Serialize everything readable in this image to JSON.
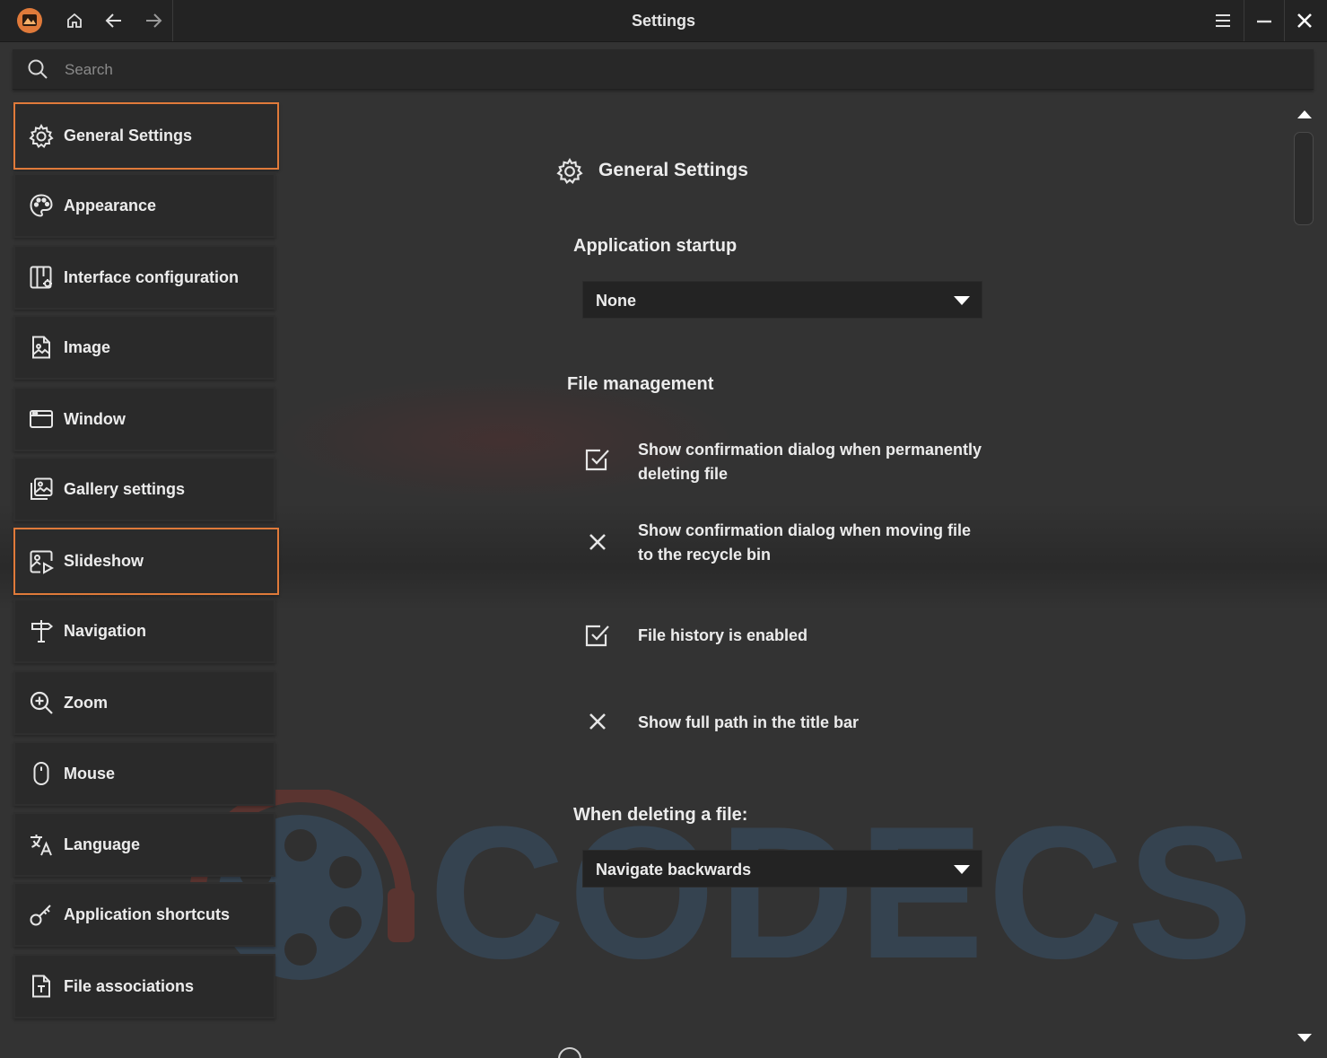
{
  "window": {
    "title": "Settings"
  },
  "search": {
    "placeholder": "Search",
    "value": ""
  },
  "sidebar": {
    "items": [
      {
        "label": "General Settings",
        "icon": "gear-icon",
        "active": true
      },
      {
        "label": "Appearance",
        "icon": "palette-icon",
        "active": false
      },
      {
        "label": "Interface configuration",
        "icon": "layout-gear-icon",
        "active": false
      },
      {
        "label": "Image",
        "icon": "image-file-icon",
        "active": false
      },
      {
        "label": "Window",
        "icon": "window-icon",
        "active": false
      },
      {
        "label": "Gallery settings",
        "icon": "gallery-icon",
        "active": false
      },
      {
        "label": "Slideshow",
        "icon": "slideshow-icon",
        "active": true
      },
      {
        "label": "Navigation",
        "icon": "signpost-icon",
        "active": false
      },
      {
        "label": "Zoom",
        "icon": "zoom-in-icon",
        "active": false
      },
      {
        "label": "Mouse",
        "icon": "mouse-icon",
        "active": false
      },
      {
        "label": "Language",
        "icon": "translate-icon",
        "active": false
      },
      {
        "label": "Application shortcuts",
        "icon": "key-icon",
        "active": false
      },
      {
        "label": "File associations",
        "icon": "file-link-icon",
        "active": false
      }
    ]
  },
  "main": {
    "section_title": "General Settings",
    "startup": {
      "heading": "Application startup",
      "value": "None"
    },
    "file_management": {
      "heading": "File management",
      "options": [
        {
          "label": "Show confirmation dialog when permanently deleting file",
          "checked": true
        },
        {
          "label": "Show confirmation dialog when moving file to the recycle bin",
          "checked": false
        },
        {
          "label": "File history is enabled",
          "checked": true
        },
        {
          "label": "Show full path in the title bar",
          "checked": false
        }
      ]
    },
    "delete_behavior": {
      "heading": "When deleting a file:",
      "value": "Navigate backwards"
    }
  },
  "watermark": {
    "text": "CODECS"
  },
  "colors": {
    "accent": "#e07a3a",
    "background": "#333333",
    "panel": "#2a2a2a",
    "titlebar": "#232323",
    "text": "#ececec"
  }
}
